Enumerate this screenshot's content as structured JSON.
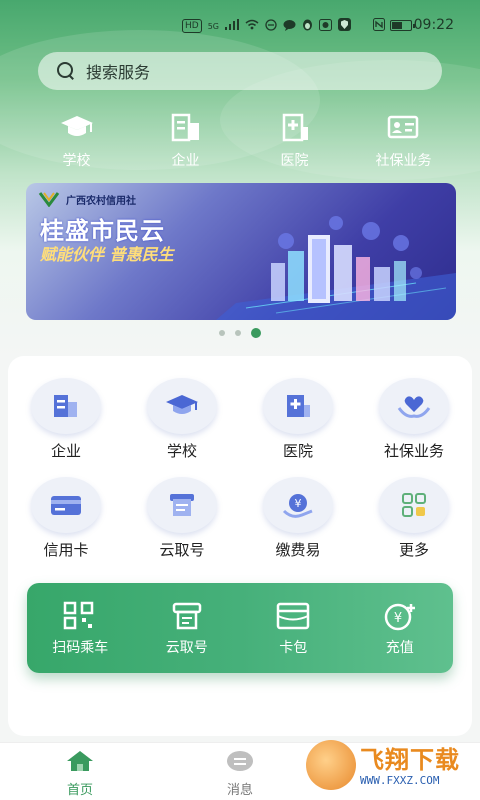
{
  "status_bar": {
    "time": "09:22",
    "chips": [
      "HD",
      "5G"
    ],
    "battery_level": 0.6
  },
  "search": {
    "placeholder": "搜索服务"
  },
  "quick_links": [
    {
      "label": "学校",
      "icon": "graduation-cap-icon"
    },
    {
      "label": "企业",
      "icon": "building-icon"
    },
    {
      "label": "医院",
      "icon": "hospital-icon"
    },
    {
      "label": "社保业务",
      "icon": "id-card-icon"
    }
  ],
  "banner": {
    "org": "广西农村信用社",
    "title": "桂盛市民云",
    "subtitle": "赋能伙伴 普惠民生"
  },
  "carousel": {
    "count": 3,
    "active": 3
  },
  "services": [
    {
      "label": "企业",
      "icon": "building-icon"
    },
    {
      "label": "学校",
      "icon": "graduation-cap-icon"
    },
    {
      "label": "医院",
      "icon": "hospital-icon"
    },
    {
      "label": "社保业务",
      "icon": "heart-hands-icon"
    },
    {
      "label": "信用卡",
      "icon": "credit-card-icon"
    },
    {
      "label": "云取号",
      "icon": "ticket-icon"
    },
    {
      "label": "缴费易",
      "icon": "payment-icon"
    },
    {
      "label": "更多",
      "icon": "grid-more-icon"
    }
  ],
  "strip": [
    {
      "label": "扫码乘车",
      "icon": "qr-scan-icon"
    },
    {
      "label": "云取号",
      "icon": "ticket-icon"
    },
    {
      "label": "卡包",
      "icon": "wallet-icon"
    },
    {
      "label": "充值",
      "icon": "yuan-plus-icon"
    }
  ],
  "tabs": [
    {
      "label": "首页",
      "icon": "home-icon",
      "active": true
    },
    {
      "label": "消息",
      "icon": "message-icon",
      "active": false
    }
  ],
  "watermark": {
    "title": "飞翔下载",
    "url": "WWW.FXXZ.COM"
  },
  "colors": {
    "primary": "#3a9a5e",
    "accent": "#46b07a"
  }
}
